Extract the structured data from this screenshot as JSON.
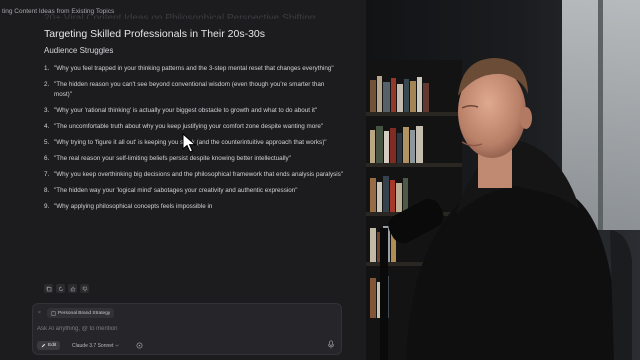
{
  "window": {
    "title": "ting Content Ideas from Existing Topics"
  },
  "document": {
    "ghost_heading": "20+ Viral Content Ideas on Philosophical Perspective Shifting",
    "heading": "Targeting Skilled Professionals in Their 20s-30s",
    "section": "Audience Struggles",
    "items": [
      {
        "num": "1.",
        "text": "\"Why you feel trapped in your thinking patterns and the 3-step mental reset that changes everything\""
      },
      {
        "num": "2.",
        "text": "\"The hidden reason you can't see beyond conventional wisdom (even though you're smarter than most)\""
      },
      {
        "num": "3.",
        "text": "\"Why your 'rational thinking' is actually your biggest obstacle to growth and what to do about it\""
      },
      {
        "num": "4.",
        "text": "\"The uncomfortable truth about why you keep justifying your comfort zone despite wanting more\""
      },
      {
        "num": "5.",
        "text": "\"Why trying to 'figure it all out' is keeping you stuck (and the counterintuitive approach that works)\""
      },
      {
        "num": "6.",
        "text": "\"The real reason your self-limiting beliefs persist despite knowing better intellectually\""
      },
      {
        "num": "7.",
        "text": "\"Why you keep overthinking big decisions and the philosophical framework that ends analysis paralysis\""
      },
      {
        "num": "8.",
        "text": "\"The hidden way your 'logical mind' sabotages your creativity and authentic expression\""
      },
      {
        "num": "9.",
        "text": "\"Why applying philosophical concepts feels impossible in"
      }
    ]
  },
  "composer": {
    "context_chip": "Personal Brand Strategy",
    "placeholder": "Ask AI anything, @ to mention",
    "mode_label": "Edit",
    "model_label": "Claude 3.7 Sonnet"
  },
  "icons": {
    "cursor": "mouse-pointer-icon",
    "copy": "copy-icon",
    "retry": "refresh-icon",
    "thumbs_up": "thumbs-up-icon",
    "thumbs_down": "thumbs-down-icon",
    "image": "image-icon",
    "send": "microphone-icon"
  },
  "colors": {
    "panel_bg": "#1c1c1e",
    "text": "#d3d3d7",
    "composer_bg": "#26262a"
  }
}
